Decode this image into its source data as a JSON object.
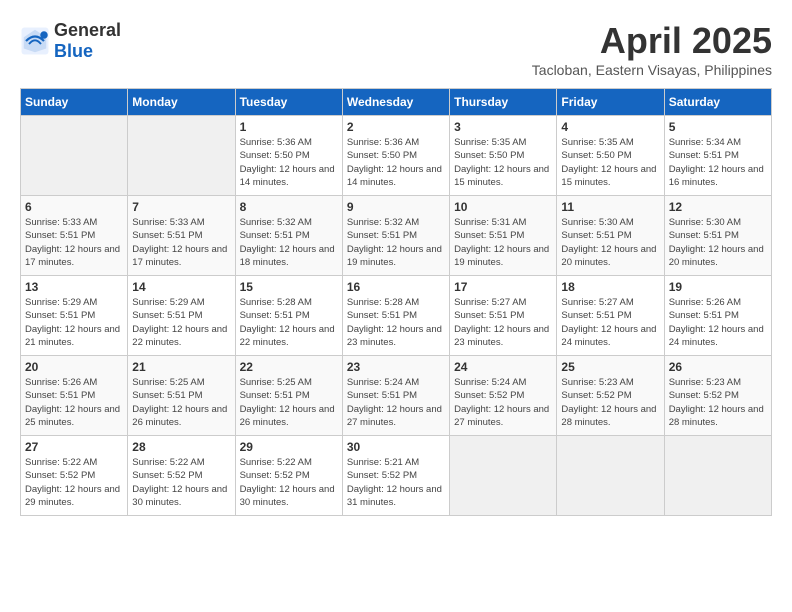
{
  "header": {
    "logo_general": "General",
    "logo_blue": "Blue",
    "month": "April 2025",
    "location": "Tacloban, Eastern Visayas, Philippines"
  },
  "weekdays": [
    "Sunday",
    "Monday",
    "Tuesday",
    "Wednesday",
    "Thursday",
    "Friday",
    "Saturday"
  ],
  "weeks": [
    [
      {
        "day": "",
        "info": ""
      },
      {
        "day": "",
        "info": ""
      },
      {
        "day": "1",
        "info": "Sunrise: 5:36 AM\nSunset: 5:50 PM\nDaylight: 12 hours and 14 minutes."
      },
      {
        "day": "2",
        "info": "Sunrise: 5:36 AM\nSunset: 5:50 PM\nDaylight: 12 hours and 14 minutes."
      },
      {
        "day": "3",
        "info": "Sunrise: 5:35 AM\nSunset: 5:50 PM\nDaylight: 12 hours and 15 minutes."
      },
      {
        "day": "4",
        "info": "Sunrise: 5:35 AM\nSunset: 5:50 PM\nDaylight: 12 hours and 15 minutes."
      },
      {
        "day": "5",
        "info": "Sunrise: 5:34 AM\nSunset: 5:51 PM\nDaylight: 12 hours and 16 minutes."
      }
    ],
    [
      {
        "day": "6",
        "info": "Sunrise: 5:33 AM\nSunset: 5:51 PM\nDaylight: 12 hours and 17 minutes."
      },
      {
        "day": "7",
        "info": "Sunrise: 5:33 AM\nSunset: 5:51 PM\nDaylight: 12 hours and 17 minutes."
      },
      {
        "day": "8",
        "info": "Sunrise: 5:32 AM\nSunset: 5:51 PM\nDaylight: 12 hours and 18 minutes."
      },
      {
        "day": "9",
        "info": "Sunrise: 5:32 AM\nSunset: 5:51 PM\nDaylight: 12 hours and 19 minutes."
      },
      {
        "day": "10",
        "info": "Sunrise: 5:31 AM\nSunset: 5:51 PM\nDaylight: 12 hours and 19 minutes."
      },
      {
        "day": "11",
        "info": "Sunrise: 5:30 AM\nSunset: 5:51 PM\nDaylight: 12 hours and 20 minutes."
      },
      {
        "day": "12",
        "info": "Sunrise: 5:30 AM\nSunset: 5:51 PM\nDaylight: 12 hours and 20 minutes."
      }
    ],
    [
      {
        "day": "13",
        "info": "Sunrise: 5:29 AM\nSunset: 5:51 PM\nDaylight: 12 hours and 21 minutes."
      },
      {
        "day": "14",
        "info": "Sunrise: 5:29 AM\nSunset: 5:51 PM\nDaylight: 12 hours and 22 minutes."
      },
      {
        "day": "15",
        "info": "Sunrise: 5:28 AM\nSunset: 5:51 PM\nDaylight: 12 hours and 22 minutes."
      },
      {
        "day": "16",
        "info": "Sunrise: 5:28 AM\nSunset: 5:51 PM\nDaylight: 12 hours and 23 minutes."
      },
      {
        "day": "17",
        "info": "Sunrise: 5:27 AM\nSunset: 5:51 PM\nDaylight: 12 hours and 23 minutes."
      },
      {
        "day": "18",
        "info": "Sunrise: 5:27 AM\nSunset: 5:51 PM\nDaylight: 12 hours and 24 minutes."
      },
      {
        "day": "19",
        "info": "Sunrise: 5:26 AM\nSunset: 5:51 PM\nDaylight: 12 hours and 24 minutes."
      }
    ],
    [
      {
        "day": "20",
        "info": "Sunrise: 5:26 AM\nSunset: 5:51 PM\nDaylight: 12 hours and 25 minutes."
      },
      {
        "day": "21",
        "info": "Sunrise: 5:25 AM\nSunset: 5:51 PM\nDaylight: 12 hours and 26 minutes."
      },
      {
        "day": "22",
        "info": "Sunrise: 5:25 AM\nSunset: 5:51 PM\nDaylight: 12 hours and 26 minutes."
      },
      {
        "day": "23",
        "info": "Sunrise: 5:24 AM\nSunset: 5:51 PM\nDaylight: 12 hours and 27 minutes."
      },
      {
        "day": "24",
        "info": "Sunrise: 5:24 AM\nSunset: 5:52 PM\nDaylight: 12 hours and 27 minutes."
      },
      {
        "day": "25",
        "info": "Sunrise: 5:23 AM\nSunset: 5:52 PM\nDaylight: 12 hours and 28 minutes."
      },
      {
        "day": "26",
        "info": "Sunrise: 5:23 AM\nSunset: 5:52 PM\nDaylight: 12 hours and 28 minutes."
      }
    ],
    [
      {
        "day": "27",
        "info": "Sunrise: 5:22 AM\nSunset: 5:52 PM\nDaylight: 12 hours and 29 minutes."
      },
      {
        "day": "28",
        "info": "Sunrise: 5:22 AM\nSunset: 5:52 PM\nDaylight: 12 hours and 30 minutes."
      },
      {
        "day": "29",
        "info": "Sunrise: 5:22 AM\nSunset: 5:52 PM\nDaylight: 12 hours and 30 minutes."
      },
      {
        "day": "30",
        "info": "Sunrise: 5:21 AM\nSunset: 5:52 PM\nDaylight: 12 hours and 31 minutes."
      },
      {
        "day": "",
        "info": ""
      },
      {
        "day": "",
        "info": ""
      },
      {
        "day": "",
        "info": ""
      }
    ]
  ]
}
